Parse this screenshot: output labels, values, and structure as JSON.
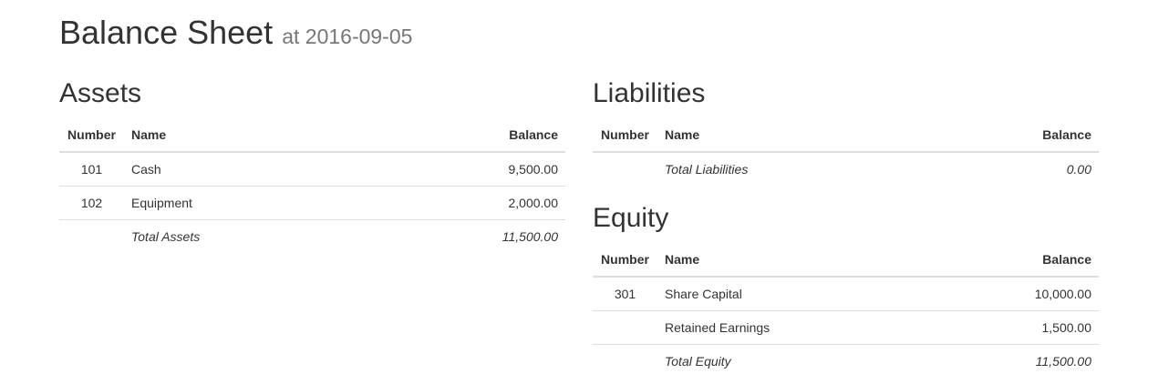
{
  "header": {
    "title": "Balance Sheet",
    "subtitle": "at 2016-09-05"
  },
  "columns": {
    "number": "Number",
    "name": "Name",
    "balance": "Balance"
  },
  "assets": {
    "heading": "Assets",
    "rows": [
      {
        "number": "101",
        "name": "Cash",
        "balance": "9,500.00"
      },
      {
        "number": "102",
        "name": "Equipment",
        "balance": "2,000.00"
      }
    ],
    "total": {
      "label": "Total Assets",
      "balance": "11,500.00"
    }
  },
  "liabilities": {
    "heading": "Liabilities",
    "rows": [],
    "total": {
      "label": "Total Liabilities",
      "balance": "0.00"
    }
  },
  "equity": {
    "heading": "Equity",
    "rows": [
      {
        "number": "301",
        "name": "Share Capital",
        "balance": "10,000.00"
      },
      {
        "number": "",
        "name": "Retained Earnings",
        "balance": "1,500.00"
      }
    ],
    "total": {
      "label": "Total Equity",
      "balance": "11,500.00"
    }
  }
}
